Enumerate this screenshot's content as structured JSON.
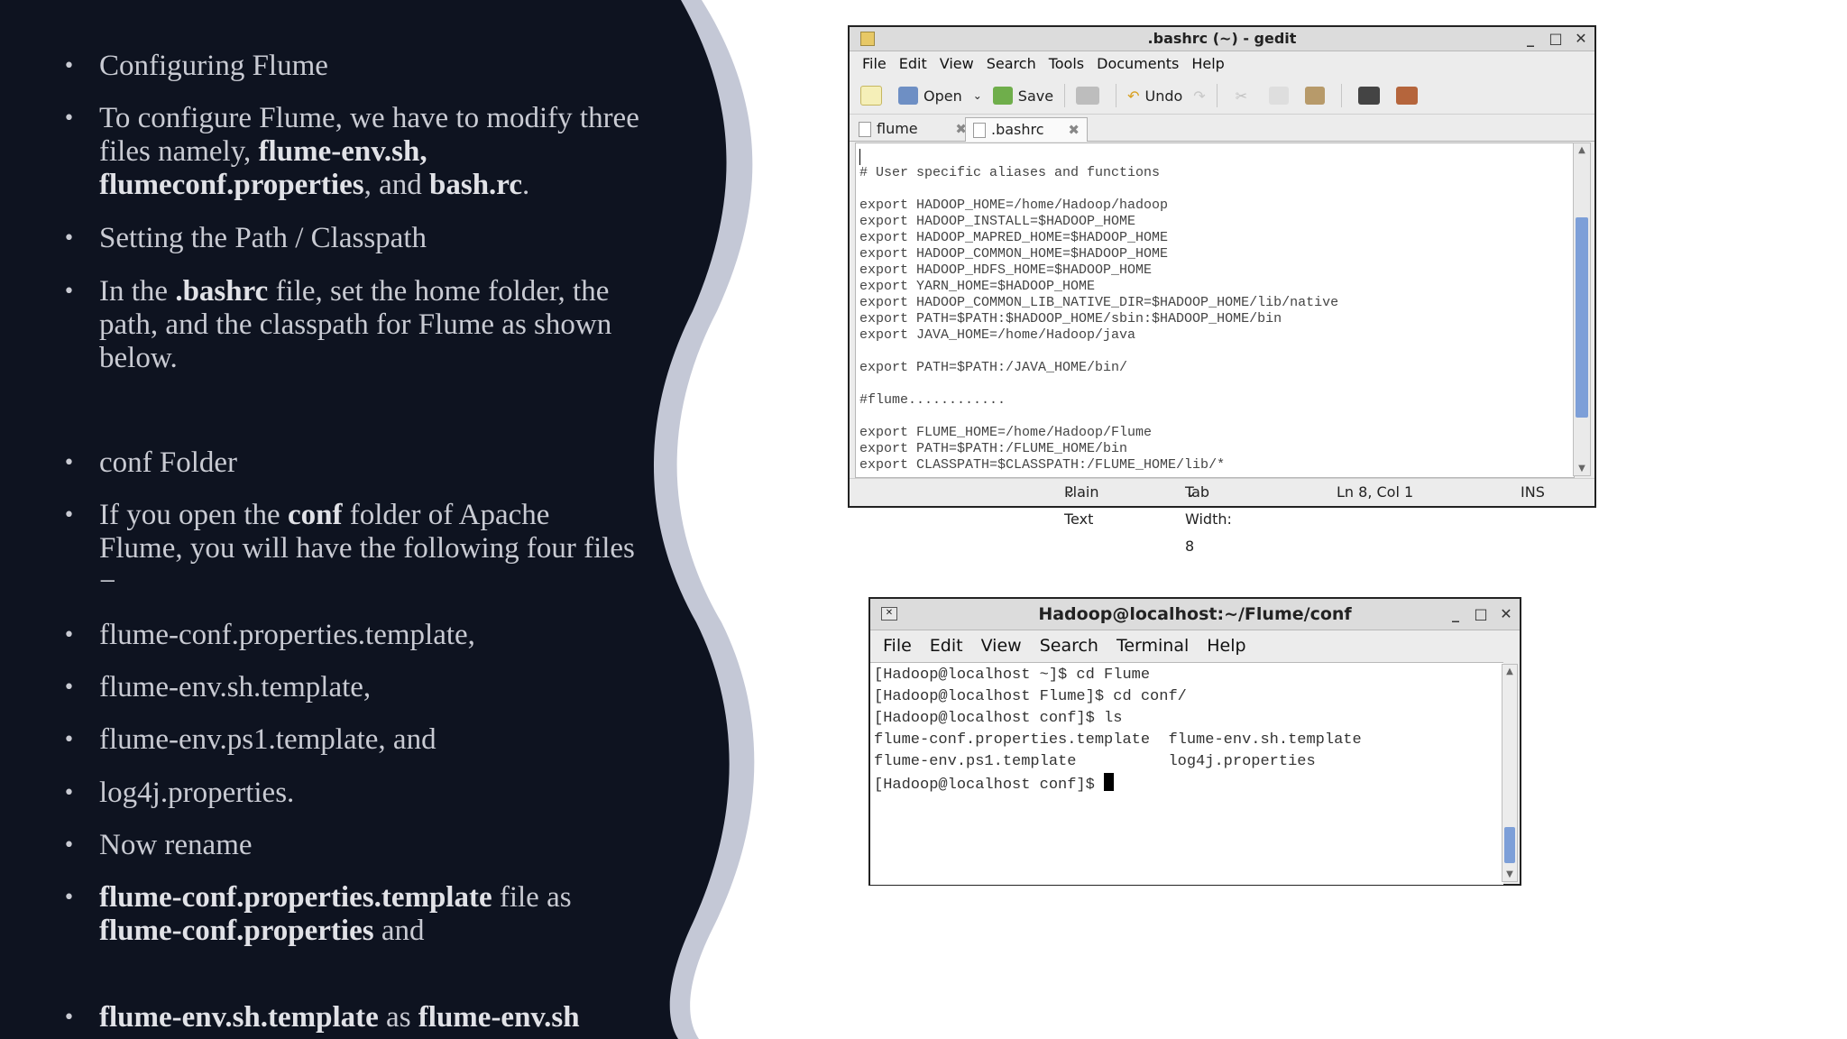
{
  "slide": {
    "bullets": [
      {
        "parts": [
          {
            "t": "Configuring Flume",
            "b": false
          }
        ]
      },
      {
        "parts": [
          {
            "t": "To configure Flume, we have to modify three files namely, ",
            "b": false
          },
          {
            "t": "flume-env.sh, flumeconf.properties",
            "b": true
          },
          {
            "t": ", and ",
            "b": false
          },
          {
            "t": "bash.rc",
            "b": true
          },
          {
            "t": ".",
            "b": false
          }
        ]
      },
      {
        "parts": [
          {
            "t": "Setting the Path / Classpath",
            "b": false
          }
        ]
      },
      {
        "parts": [
          {
            "t": "In the ",
            "b": false
          },
          {
            "t": ".bashrc",
            "b": true
          },
          {
            "t": " file, set the home folder, the path, and the classpath for Flume as shown below.",
            "b": false
          }
        ]
      },
      {
        "parts": [
          {
            "t": "conf Folder",
            "b": false
          }
        ]
      },
      {
        "parts": [
          {
            "t": "If you open the ",
            "b": false
          },
          {
            "t": "conf",
            "b": true
          },
          {
            "t": " folder of Apache Flume, you will have the following four files −",
            "b": false
          }
        ]
      },
      {
        "parts": [
          {
            "t": "flume-conf.properties.template,",
            "b": false
          }
        ]
      },
      {
        "parts": [
          {
            "t": "flume-env.sh.template,",
            "b": false
          }
        ]
      },
      {
        "parts": [
          {
            "t": "flume-env.ps1.template, and",
            "b": false
          }
        ]
      },
      {
        "parts": [
          {
            "t": "log4j.properties.",
            "b": false
          }
        ]
      },
      {
        "parts": [
          {
            "t": "Now rename",
            "b": false
          }
        ]
      },
      {
        "parts": [
          {
            "t": "flume-conf.properties.template",
            "b": true
          },
          {
            "t": " file as ",
            "b": false
          },
          {
            "t": "flume-conf.properties",
            "b": true
          },
          {
            "t": " and",
            "b": false
          }
        ]
      },
      {
        "parts": [
          {
            "t": "flume-env.sh.template",
            "b": true
          },
          {
            "t": " as ",
            "b": false
          },
          {
            "t": "flume-env.sh",
            "b": true
          }
        ]
      }
    ]
  },
  "gedit": {
    "title": ".bashrc (~) - gedit",
    "window_buttons": [
      "_",
      "□",
      "✕"
    ],
    "menu": [
      "File",
      "Edit",
      "View",
      "Search",
      "Tools",
      "Documents",
      "Help"
    ],
    "toolbar": {
      "open": "Open",
      "save": "Save",
      "undo": "Undo"
    },
    "tabs": [
      {
        "label": "flume",
        "active": false
      },
      {
        "label": ".bashrc",
        "active": true
      }
    ],
    "code_lines": [
      "",
      "# User specific aliases and functions",
      "",
      "export HADOOP_HOME=/home/Hadoop/hadoop",
      "export HADOOP_INSTALL=$HADOOP_HOME",
      "export HADOOP_MAPRED_HOME=$HADOOP_HOME",
      "export HADOOP_COMMON_HOME=$HADOOP_HOME",
      "export HADOOP_HDFS_HOME=$HADOOP_HOME",
      "export YARN_HOME=$HADOOP_HOME",
      "export HADOOP_COMMON_LIB_NATIVE_DIR=$HADOOP_HOME/lib/native",
      "export PATH=$PATH:$HADOOP_HOME/sbin:$HADOOP_HOME/bin",
      "export JAVA_HOME=/home/Hadoop/java",
      "",
      "export PATH=$PATH:/JAVA_HOME/bin/",
      "",
      "#flume............",
      "",
      "export FLUME_HOME=/home/Hadoop/Flume",
      "export PATH=$PATH:/FLUME_HOME/bin",
      "export CLASSPATH=$CLASSPATH:/FLUME_HOME/lib/*"
    ],
    "status": {
      "language": "Plain Text",
      "tab_width": "Tab Width:  8",
      "position": "Ln 8, Col 1",
      "mode": "INS"
    }
  },
  "terminal": {
    "title": "Hadoop@localhost:~/Flume/conf",
    "window_buttons": [
      "_",
      "□",
      "✕"
    ],
    "menu": [
      "File",
      "Edit",
      "View",
      "Search",
      "Terminal",
      "Help"
    ],
    "lines": [
      "[Hadoop@localhost ~]$ cd Flume",
      "[Hadoop@localhost Flume]$ cd conf/",
      "[Hadoop@localhost conf]$ ls",
      "flume-conf.properties.template  flume-env.sh.template",
      "flume-env.ps1.template          log4j.properties"
    ],
    "prompt": "[Hadoop@localhost conf]$ "
  },
  "colors": {
    "panel": "#0e1320",
    "wave_edge": "#c4c8d6",
    "accent_scroll": "#7d9fd8"
  }
}
